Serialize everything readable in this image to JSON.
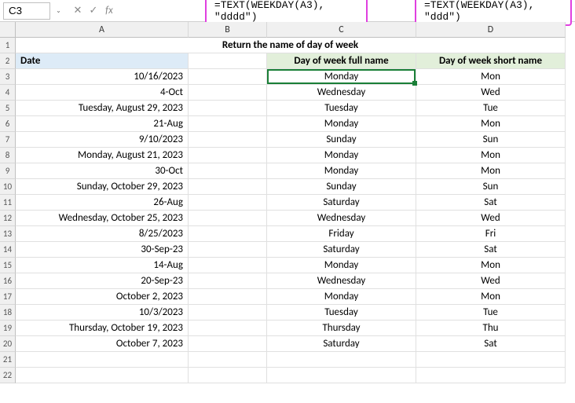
{
  "name_box": "C3",
  "formula_input": "",
  "formula_highlights": {
    "c": "=TEXT(WEEKDAY(A3), \"dddd\")",
    "d": "=TEXT(WEEKDAY(A3), \"ddd\")"
  },
  "title": "Return the name of day of week",
  "columns": [
    "A",
    "B",
    "C",
    "D"
  ],
  "header_labels": {
    "date": "Date",
    "full": "Day of week full name",
    "short": "Day of week short name"
  },
  "rows": [
    {
      "date": "10/16/2023",
      "full": "Monday",
      "short": "Mon"
    },
    {
      "date": "4-Oct",
      "full": "Wednesday",
      "short": "Wed"
    },
    {
      "date": "Tuesday, August 29, 2023",
      "full": "Tuesday",
      "short": "Tue"
    },
    {
      "date": "21-Aug",
      "full": "Monday",
      "short": "Mon"
    },
    {
      "date": "9/10/2023",
      "full": "Sunday",
      "short": "Sun"
    },
    {
      "date": "Monday, August 21, 2023",
      "full": "Monday",
      "short": "Mon"
    },
    {
      "date": "30-Oct",
      "full": "Monday",
      "short": "Mon"
    },
    {
      "date": "Sunday, October 29, 2023",
      "full": "Sunday",
      "short": "Sun"
    },
    {
      "date": "26-Aug",
      "full": "Saturday",
      "short": "Sat"
    },
    {
      "date": "Wednesday, October 25, 2023",
      "full": "Wednesday",
      "short": "Wed"
    },
    {
      "date": "8/25/2023",
      "full": "Friday",
      "short": "Fri"
    },
    {
      "date": "30-Sep-23",
      "full": "Saturday",
      "short": "Sat"
    },
    {
      "date": "14-Aug",
      "full": "Monday",
      "short": "Mon"
    },
    {
      "date": "20-Sep-23",
      "full": "Wednesday",
      "short": "Wed"
    },
    {
      "date": "October 2, 2023",
      "full": "Monday",
      "short": "Mon"
    },
    {
      "date": "10/3/2023",
      "full": "Tuesday",
      "short": "Tue"
    },
    {
      "date": "Thursday, October 19, 2023",
      "full": "Thursday",
      "short": "Thu"
    },
    {
      "date": "October 7, 2023",
      "full": "Saturday",
      "short": "Sat"
    }
  ],
  "selected_cell": "C3",
  "icons": {
    "fx": "fx",
    "cancel": "✕",
    "confirm": "✓",
    "chevron": "⌄"
  }
}
